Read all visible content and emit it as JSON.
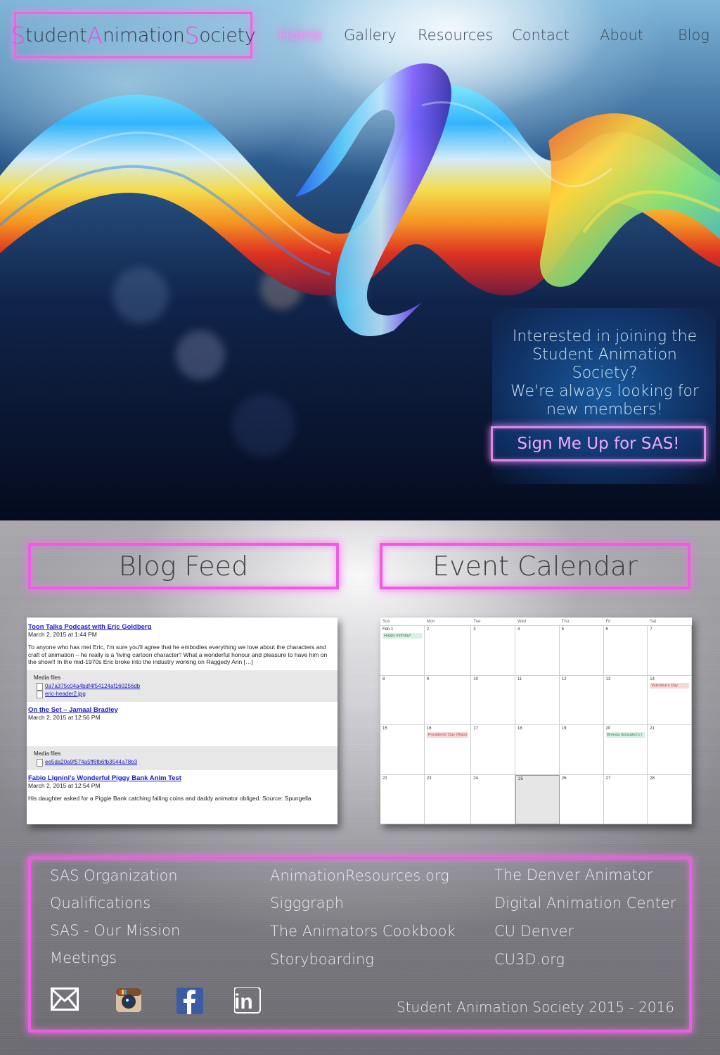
{
  "brand": {
    "parts": [
      {
        "cap": "S",
        "rest": "tudent"
      },
      {
        "cap": "A",
        "rest": "nimation"
      },
      {
        "cap": "S",
        "rest": "ociety"
      }
    ],
    "accent": "#e94ee0"
  },
  "nav": {
    "items": [
      "Home",
      "Gallery",
      "Resources",
      "Contact",
      "About",
      "Blog"
    ],
    "active": "Home"
  },
  "join": {
    "lines": [
      "Interested in joining the",
      "Student Animation",
      "Society?",
      "We're always looking for",
      "new members!"
    ],
    "button": "Sign Me Up for SAS!"
  },
  "sections": {
    "blog_title": "Blog Feed",
    "calendar_title": "Event Calendar"
  },
  "blog": {
    "posts": [
      {
        "title": "Toon Talks Podcast with Eric Goldberg",
        "date": "March 2, 2015 at 1:44 PM",
        "body": "To anyone who has met Eric, I'm sure you'll agree that he embodies everything we love about the characters and craft of animation – he really is a 'living cartoon character'! What a wonderful honour and pleasure to have him on the show!! In the mid-1970s Eric broke into the industry working on Raggedy Ann […]",
        "media_label": "Media files",
        "files": [
          "0a7a375c04a4bdf4f54124af160256db",
          "eric-header2.jpg"
        ]
      },
      {
        "title": "On the Set – Jamaal Bradley",
        "date": "March 2, 2015 at 12:56 PM",
        "body": "",
        "media_label": "Media files",
        "files": [
          "ee5da20a9f574a5ff6fb6fb3544a78b3"
        ]
      },
      {
        "title": "Fabio Lignini's Wonderful Piggy Bank Anim Test",
        "date": "March 2, 2015 at 12:54 PM",
        "body": "His daughter asked for a Piggie Bank catching falling coins and daddy animator obliged. Source: Spungella",
        "media_label": "",
        "files": []
      }
    ]
  },
  "calendar": {
    "days": [
      "Sun",
      "Mon",
      "Tue",
      "Wed",
      "Thu",
      "Fri",
      "Sat"
    ],
    "weeks": [
      [
        "Feb 1",
        "2",
        "3",
        "4",
        "5",
        "6",
        "7"
      ],
      [
        "8",
        "9",
        "10",
        "11",
        "12",
        "13",
        "14"
      ],
      [
        "15",
        "16",
        "17",
        "18",
        "19",
        "20",
        "21"
      ],
      [
        "22",
        "23",
        "24",
        "25",
        "26",
        "27",
        "28"
      ]
    ],
    "today": "25",
    "events": {
      "Feb 1": {
        "label": "Happy birthday!",
        "kind": "green"
      },
      "14": {
        "label": "Valentine's Day",
        "kind": "red"
      },
      "16": {
        "label": "Presidents' Day (Wash",
        "kind": "red"
      },
      "20": {
        "label": "Brenda Gonzalez's I",
        "kind": "green"
      }
    }
  },
  "footer": {
    "col1": [
      "SAS Organization",
      "Qualifications",
      "SAS - Our Mission",
      "Meetings"
    ],
    "col2": [
      "AnimationResources.org",
      "Sigggraph",
      "The Animators Cookbook",
      "Storyboarding"
    ],
    "col3": [
      "The Denver Animator",
      "Digital Animation Center",
      "CU Denver",
      "CU3D.org"
    ],
    "social": [
      "mail-icon",
      "instagram-icon",
      "facebook-icon",
      "linkedin-icon"
    ],
    "copyright": "Student Animation Society 2015 - 2016"
  }
}
